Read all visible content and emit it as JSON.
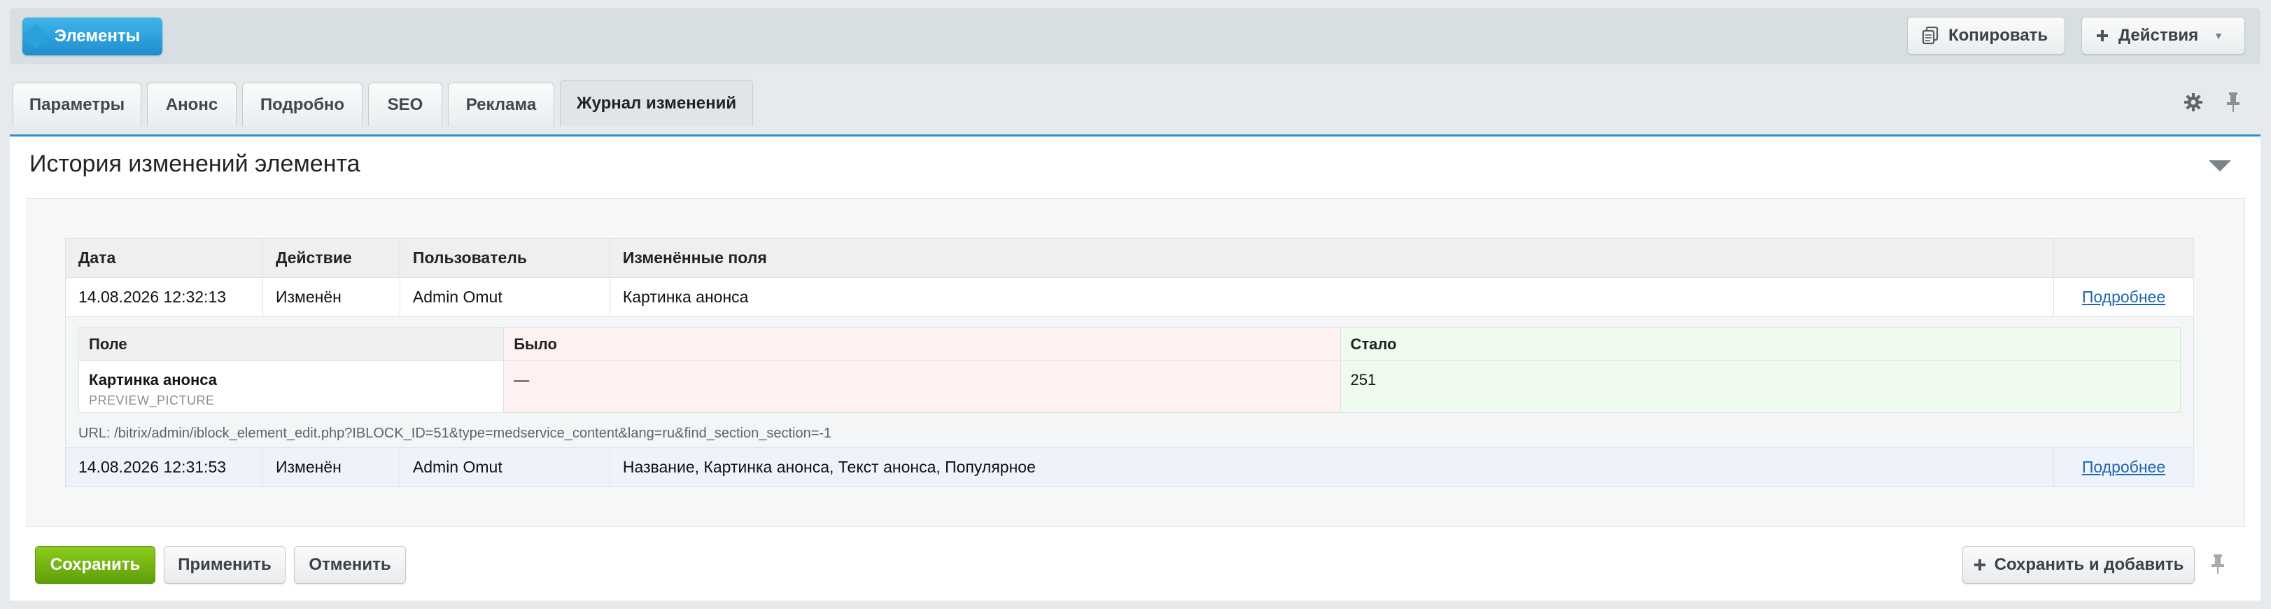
{
  "toolbar": {
    "back_label": "Элементы",
    "copy_label": "Копировать",
    "actions_label": "Действия"
  },
  "tabs": [
    {
      "label": "Параметры"
    },
    {
      "label": "Анонс"
    },
    {
      "label": "Подробно"
    },
    {
      "label": "SEO"
    },
    {
      "label": "Реклама"
    },
    {
      "label": "Журнал изменений",
      "active": true
    }
  ],
  "panel": {
    "title": "История изменений элемента"
  },
  "history": {
    "columns": [
      "Дата",
      "Действие",
      "Пользователь",
      "Изменённые поля",
      ""
    ],
    "rows": [
      {
        "date": "14.08.2026 12:32:13",
        "action": "Изменён",
        "user": "Admin Omut",
        "fields": "Картинка анонса",
        "link": "Подробнее"
      },
      {
        "date": "14.08.2026 12:31:53",
        "action": "Изменён",
        "user": "Admin Omut",
        "fields": "Название, Картинка анонса, Текст анонса, Популярное",
        "link": "Подробнее"
      }
    ],
    "detail": {
      "columns": [
        "Поле",
        "Было",
        "Стало"
      ],
      "rows": [
        {
          "field_name": "Картинка анонса",
          "field_code": "PREVIEW_PICTURE",
          "was": "—",
          "now": "251"
        }
      ],
      "url": "URL: /bitrix/admin/iblock_element_edit.php?IBLOCK_ID=51&type=medservice_content&lang=ru&find_section_section=-1"
    }
  },
  "footer": {
    "save_label": "Сохранить",
    "apply_label": "Применить",
    "cancel_label": "Отменить",
    "save_add_label": "Сохранить и добавить"
  },
  "colors": {
    "accent_blue": "#2a8fcf",
    "save_green": "#6aae0f",
    "link": "#2067b0"
  }
}
